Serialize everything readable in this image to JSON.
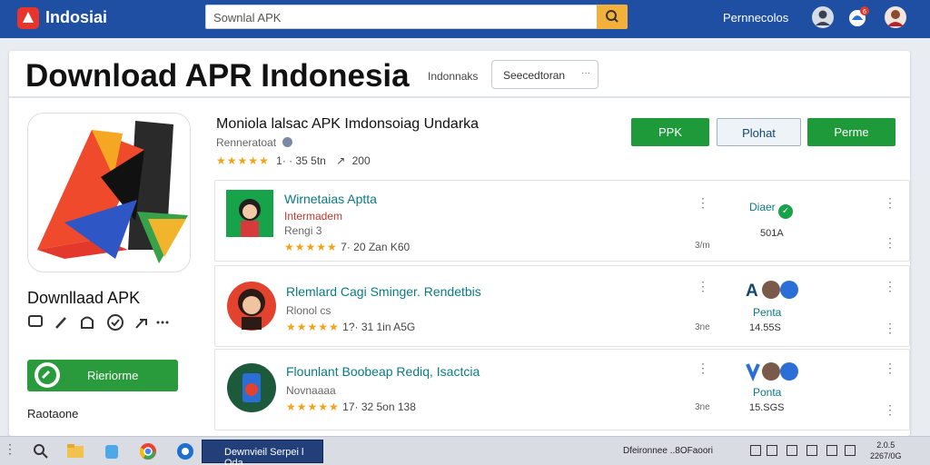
{
  "topbar": {
    "brand": "Indosiai",
    "search_value": "Sownlal APK",
    "account_label": "Pernnecolos",
    "notification_badge": "6",
    "colors": {
      "bar": "#1f4fa3",
      "search_button": "#f3b13b"
    }
  },
  "page": {
    "title": "Download APR Indonesia",
    "title_side_label": "Indonnaks",
    "select_value": "Seecedtoran"
  },
  "app": {
    "name": "Moniola lalsac APK Imdonsoiag Undarka",
    "publisher": "Renneratoat",
    "rating_stars": "★★★★★",
    "rating_text": "1· · 35 5tn",
    "share_count": "200",
    "left_title": "Downllaad APK",
    "green_button_label": "Rieriorme",
    "left_footer": "Raotaone",
    "buttons": [
      {
        "label": "PPK",
        "style": "green"
      },
      {
        "label": "Plohat",
        "style": "outline"
      },
      {
        "label": "Perme",
        "style": "green"
      }
    ]
  },
  "list": [
    {
      "title": "Wirnetaias Aptta",
      "subtitle": "Intermadem",
      "developer": "Rengi 3",
      "stars": "★★★★★",
      "stats": "7·  20 Zan K60",
      "mid_label": "3/m",
      "status": "Diaer",
      "value": "501A"
    },
    {
      "title": "Rlemlard Cagi Sminger. Rendetbis",
      "subtitle": "",
      "developer": "Rlonol cs",
      "stars": "★★★★★",
      "stats": "1?·  31 1in A5G",
      "mid_label": "3ne",
      "status": "Penta",
      "value": "14.55S"
    },
    {
      "title": "Flounlant Boobeap Rediq, Isactcia",
      "subtitle": "",
      "developer": "Novnaaaa",
      "stars": "★★★★★",
      "stats": "17·  32 5on 138",
      "mid_label": "3ne",
      "status": "Ponta",
      "value": "15.SGS"
    }
  ],
  "taskbar": {
    "active_window": "Dewnvieil Serpei l Oda",
    "tray_text": "Dfeironnee ..8OFaoori",
    "clock_time": "2.0.5",
    "clock_date": "2267/0G"
  }
}
